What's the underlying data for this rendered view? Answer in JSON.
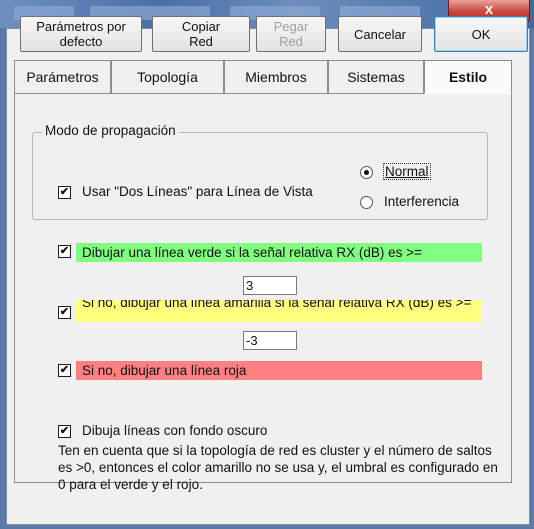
{
  "titlebar": {
    "close_label": "x"
  },
  "toolbar": {
    "default_params_label": "Parámetros por\ndefecto",
    "copy_net_label": "Copiar\nRed",
    "paste_net_label": "Pegar\nRed",
    "cancel_label": "Cancelar",
    "ok_label": "OK"
  },
  "tabs": [
    {
      "label": "Parámetros",
      "active": false
    },
    {
      "label": "Topología",
      "active": false
    },
    {
      "label": "Miembros",
      "active": false
    },
    {
      "label": "Sistemas",
      "active": false
    },
    {
      "label": "Estilo",
      "active": true
    }
  ],
  "propagation": {
    "title": "Modo de propagación",
    "two_lines_label": "Usar \"Dos Líneas\" para Línea de Vista",
    "two_lines_checked": true,
    "mode_normal_label": "Normal",
    "mode_interference_label": "Interferencia",
    "selected_mode": "Normal"
  },
  "thresholds": {
    "green_label": "Dibujar una línea verde si la señal relativa RX (dB) es >=",
    "green_checked": true,
    "green_value": "3",
    "yellow_label": "Si no, dibujar una línea amarilla si la señal relativa RX (dB) es >=",
    "yellow_checked": true,
    "yellow_value": "-3",
    "red_label": "Si no, dibujar una línea roja",
    "red_checked": true
  },
  "dark_background": {
    "label": "Dibuja líneas con fondo oscuro",
    "checked": true
  },
  "note": "Ten en cuenta que si la topología de red es cluster y el número de saltos es >0, entonces el color amarillo no se usa y, el umbral es configurado en 0 para el verde y el rojo.",
  "colors": {
    "green": "#80ff80",
    "yellow": "#ffff80",
    "red": "#ff8080"
  }
}
